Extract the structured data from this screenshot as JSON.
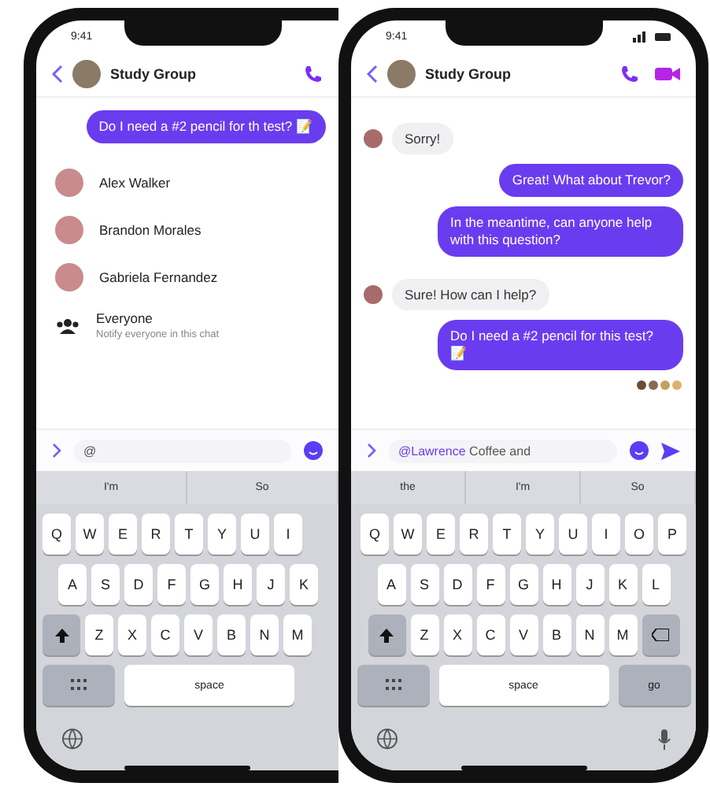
{
  "phones": [
    {
      "cut_right": true,
      "status_time": "9:41",
      "header": {
        "title": "Study Group",
        "video": false
      },
      "messages": [
        {
          "kind": "outgoing",
          "text": "Do I need a #2 pencil for th test? 📝"
        }
      ],
      "mentions": [
        {
          "name": "Alex Walker"
        },
        {
          "name": "Brandon Morales"
        },
        {
          "name": "Gabriela Fernandez"
        }
      ],
      "everyone": {
        "label": "Everyone",
        "sub": "Notify everyone in this chat"
      },
      "input": {
        "value": "@"
      },
      "send": false,
      "keyboard": {
        "suggestions": [
          "I'm",
          "So"
        ],
        "rows": [
          [
            "Q",
            "W",
            "E",
            "R",
            "T",
            "Y",
            "U",
            "I"
          ],
          [
            "A",
            "S",
            "D",
            "F",
            "G",
            "H",
            "J",
            "K"
          ],
          [
            "Z",
            "X",
            "C",
            "V",
            "B",
            "N",
            "M"
          ]
        ],
        "delete": false,
        "space": "space"
      }
    },
    {
      "cut_right": false,
      "status_time": "9:41",
      "header": {
        "title": "Study Group",
        "video": true
      },
      "messages": [
        {
          "kind": "incoming",
          "text": "Sorry!"
        },
        {
          "kind": "outgoing",
          "text": "Great! What about Trevor?"
        },
        {
          "kind": "outgoing",
          "text": "In the meantime, can anyone help with this question?"
        },
        {
          "kind": "incoming",
          "text": "Sure! How can I help?"
        },
        {
          "kind": "outgoing",
          "text": "Do I need a #2 pencil for this test? 📝"
        }
      ],
      "input": {
        "mention": "@Lawrence",
        "value": " Coffee and"
      },
      "send": true,
      "keyboard": {
        "suggestions": [
          "the",
          "I'm",
          "So"
        ],
        "rows": [
          [
            "Q",
            "W",
            "E",
            "R",
            "T",
            "Y",
            "U",
            "I",
            "O",
            "P"
          ],
          [
            "A",
            "S",
            "D",
            "F",
            "G",
            "H",
            "J",
            "K",
            "L"
          ],
          [
            "Z",
            "X",
            "C",
            "V",
            "B",
            "N",
            "M"
          ]
        ],
        "delete": true,
        "space": "space",
        "return": "go"
      }
    }
  ]
}
